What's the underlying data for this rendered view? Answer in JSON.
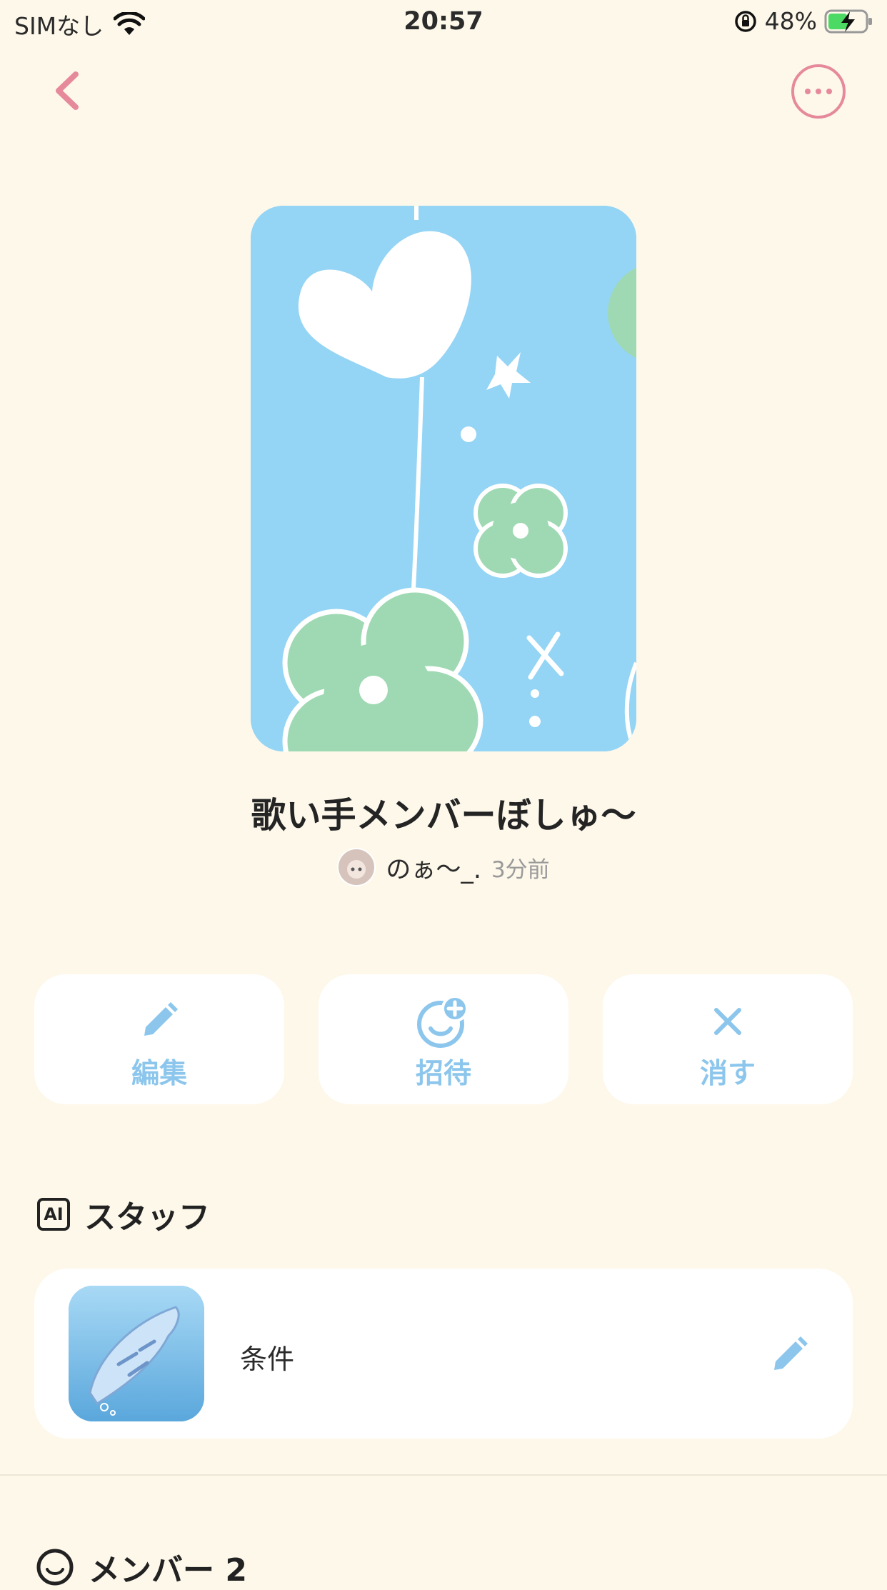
{
  "status_bar": {
    "carrier": "SIMなし",
    "time": "20:57",
    "battery": "48%"
  },
  "post": {
    "title": "歌い手メンバーぼしゅ～",
    "author": "のぁ～_.",
    "posted": "3分前"
  },
  "actions": {
    "edit_label": "編集",
    "invite_label": "招待",
    "delete_label": "消す"
  },
  "staff": {
    "section_title": "スタッフ",
    "ai_badge": "AI",
    "item_label": "条件"
  },
  "members": {
    "section_title": "メンバー 2"
  },
  "colors": {
    "background": "#fdf8ea",
    "accent_pink": "#e6899a",
    "accent_blue": "#8cc6ec",
    "cover_blue": "#94d4f5",
    "cover_green": "#9fd9b3"
  }
}
